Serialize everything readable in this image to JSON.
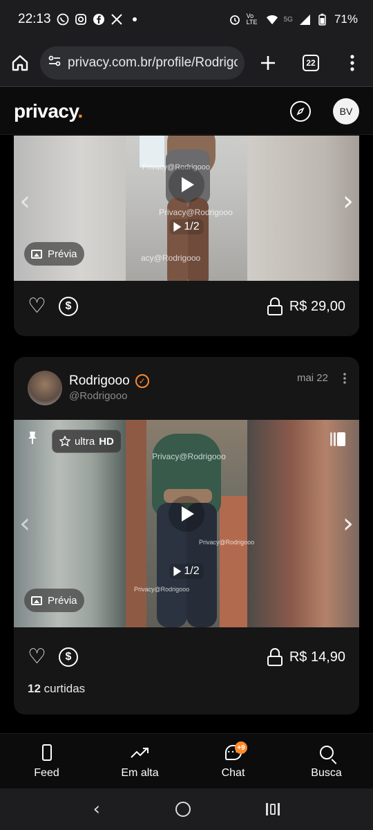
{
  "status_bar": {
    "time": "22:13",
    "network": "5G",
    "volte": "Vo LTE",
    "battery": "71%"
  },
  "browser": {
    "url": "privacy.com.br/profile/Rodrigooo",
    "tab_count": "22"
  },
  "app_header": {
    "logo": "privacy",
    "logo_dot": ".",
    "avatar_initials": "BV"
  },
  "posts": [
    {
      "media": {
        "counter": "1/2",
        "watermark_a": "Privacy@Rodrigooo",
        "watermark_b": "Privacy@Rodrigooo",
        "watermark_c": "acy@Rodrigooo",
        "preview_label": "Prévia"
      },
      "price": "R$ 29,00"
    },
    {
      "author_name": "Rodrigooo",
      "author_handle": "@Rodrigooo",
      "date": "mai 22",
      "media": {
        "quality_label": "ultra",
        "quality_bold": "HD",
        "counter": "1/2",
        "watermark_a": "Privacy@Rodrigooo",
        "watermark_b": "Privacy@Rodrigooo",
        "watermark_c": "Privacy@Rodrigooo",
        "preview_label": "Prévia"
      },
      "price": "R$ 14,90",
      "likes_count": "12",
      "likes_label": " curtidas"
    }
  ],
  "bottom_nav": {
    "items": [
      {
        "label": "Feed"
      },
      {
        "label": "Em alta"
      },
      {
        "label": "Chat",
        "badge": "+9"
      },
      {
        "label": "Busca"
      }
    ]
  },
  "colors": {
    "accent": "#ff8a2a",
    "background": "#000000",
    "card": "#161616"
  }
}
